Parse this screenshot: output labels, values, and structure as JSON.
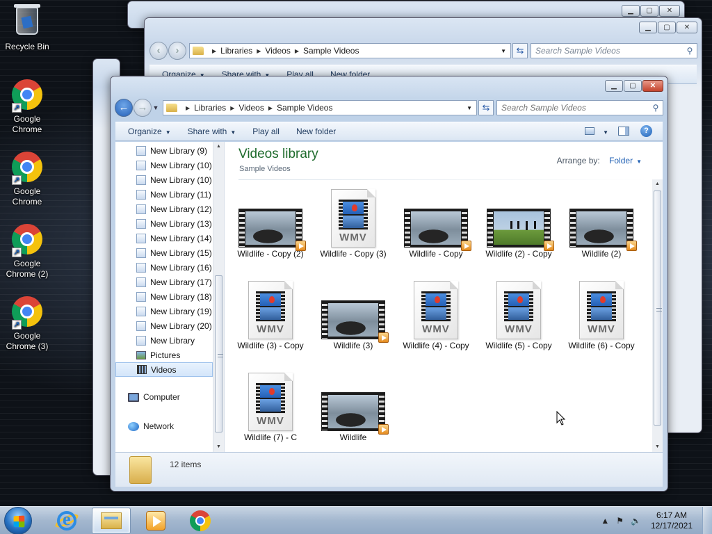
{
  "desktop": {
    "icons": [
      {
        "label": "Recycle Bin",
        "icon": "recycle-bin-icon"
      },
      {
        "label": "Google Chrome",
        "icon": "chrome-icon"
      },
      {
        "label": "Google Chrome",
        "icon": "chrome-icon"
      },
      {
        "label": "Google Chrome (2)",
        "icon": "chrome-icon"
      },
      {
        "label": "Google Chrome (3)",
        "icon": "chrome-icon"
      }
    ]
  },
  "back_window": {
    "breadcrumb": [
      "Libraries",
      "Videos",
      "Sample Videos"
    ],
    "search_placeholder": "Search Sample Videos",
    "toolbar": [
      "Organize",
      "Share with",
      "Play all",
      "New folder"
    ]
  },
  "window": {
    "breadcrumb": [
      "Libraries",
      "Videos",
      "Sample Videos"
    ],
    "search_placeholder": "Search Sample Videos",
    "toolbar": {
      "organize": "Organize",
      "share_with": "Share with",
      "play_all": "Play all",
      "new_folder": "New folder"
    },
    "nav_pane": {
      "items": [
        "New Library (9)",
        "New Library (10)",
        "New Library (10)",
        "New Library (11)",
        "New Library (12)",
        "New Library (13)",
        "New Library (14)",
        "New Library (15)",
        "New Library (16)",
        "New Library (17)",
        "New Library (18)",
        "New Library (19)",
        "New Library (20)",
        "New Library",
        "Pictures",
        "Videos"
      ],
      "selected": "Videos",
      "computer": "Computer",
      "network": "Network"
    },
    "library": {
      "title": "Videos library",
      "subtitle": "Sample Videos",
      "arrange_label": "Arrange by:",
      "arrange_value": "Folder"
    },
    "files": [
      {
        "name": "Wildlife - Copy (2)",
        "kind": "video-rock"
      },
      {
        "name": "Wildlife - Copy (3)",
        "kind": "wmv"
      },
      {
        "name": "Wildlife - Copy",
        "kind": "video-rock"
      },
      {
        "name": "Wildlife (2) - Copy",
        "kind": "video-birds"
      },
      {
        "name": "Wildlife (2)",
        "kind": "video-rock"
      },
      {
        "name": "Wildlife (3) - Copy",
        "kind": "wmv"
      },
      {
        "name": "Wildlife (3)",
        "kind": "video-rock"
      },
      {
        "name": "Wildlife (4) - Copy",
        "kind": "wmv"
      },
      {
        "name": "Wildlife (5) - Copy",
        "kind": "wmv"
      },
      {
        "name": "Wildlife (6) - Copy",
        "kind": "wmv"
      },
      {
        "name": "Wildlife (7) - C",
        "kind": "wmv"
      },
      {
        "name": "Wildlife",
        "kind": "video-rock"
      }
    ],
    "wmv_badge": "WMV",
    "status": "12 items"
  },
  "taskbar": {
    "apps": [
      "start-orb",
      "internet-explorer-icon",
      "windows-explorer-icon",
      "windows-media-player-icon",
      "chrome-icon"
    ],
    "time": "6:17 AM",
    "date": "12/17/2021"
  }
}
